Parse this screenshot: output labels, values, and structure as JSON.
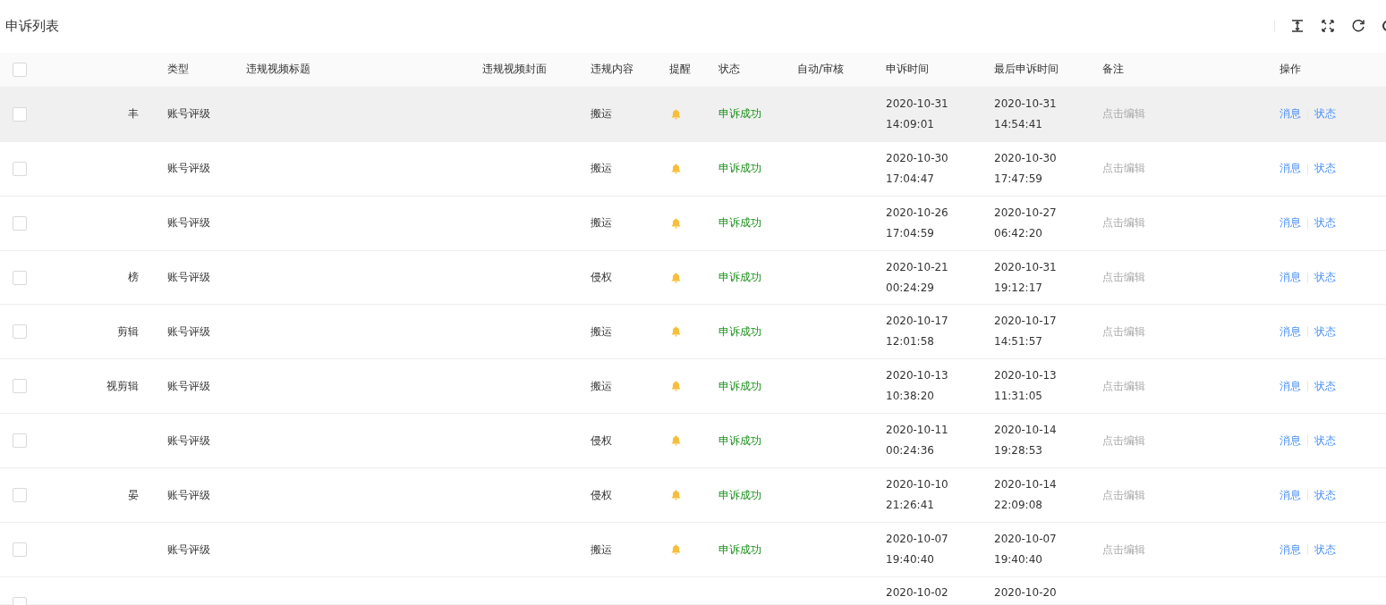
{
  "title": "申诉列表",
  "toolbar": [
    {
      "kind": "height"
    },
    {
      "kind": "fullscreen"
    },
    {
      "kind": "refresh"
    },
    {
      "kind": "settings"
    }
  ],
  "table": {
    "select_all": {
      "checked": false
    },
    "columns": [
      "",
      "类型",
      "违规视频标题",
      "违规视频封面",
      "违规内容",
      "提醒",
      "状态",
      "自动/审核",
      "申诉时间",
      "最后申诉时间",
      "备注",
      "操作"
    ],
    "rows": [
      {
        "kind": "full",
        "hovered": true,
        "checked": false,
        "name": "丰",
        "type": "账号评级",
        "content": "搬运",
        "status": "申诉成功",
        "appeal_date": "2020-10-31",
        "appeal_time": "14:09:01",
        "last_date": "2020-10-31",
        "last_time": "14:54:41",
        "remark": "点击编辑",
        "actions": [
          "消息",
          "状态"
        ]
      },
      {
        "kind": "full",
        "hovered": false,
        "checked": false,
        "name": "",
        "type": "账号评级",
        "content": "搬运",
        "status": "申诉成功",
        "appeal_date": "2020-10-30",
        "appeal_time": "17:04:47",
        "last_date": "2020-10-30",
        "last_time": "17:47:59",
        "remark": "点击编辑",
        "actions": [
          "消息",
          "状态"
        ]
      },
      {
        "kind": "full",
        "hovered": false,
        "checked": false,
        "name": "",
        "type": "账号评级",
        "content": "搬运",
        "status": "申诉成功",
        "appeal_date": "2020-10-26",
        "appeal_time": "17:04:59",
        "last_date": "2020-10-27",
        "last_time": "06:42:20",
        "remark": "点击编辑",
        "actions": [
          "消息",
          "状态"
        ]
      },
      {
        "kind": "full",
        "hovered": false,
        "checked": false,
        "name": "榜",
        "type": "账号评级",
        "content": "侵权",
        "status": "申诉成功",
        "appeal_date": "2020-10-21",
        "appeal_time": "00:24:29",
        "last_date": "2020-10-31",
        "last_time": "19:12:17",
        "remark": "点击编辑",
        "actions": [
          "消息",
          "状态"
        ]
      },
      {
        "kind": "full",
        "hovered": false,
        "checked": false,
        "name": "剪辑",
        "type": "账号评级",
        "content": "搬运",
        "status": "申诉成功",
        "appeal_date": "2020-10-17",
        "appeal_time": "12:01:58",
        "last_date": "2020-10-17",
        "last_time": "14:51:57",
        "remark": "点击编辑",
        "actions": [
          "消息",
          "状态"
        ]
      },
      {
        "kind": "full",
        "hovered": false,
        "checked": false,
        "name": "视剪辑",
        "type": "账号评级",
        "content": "搬运",
        "status": "申诉成功",
        "appeal_date": "2020-10-13",
        "appeal_time": "10:38:20",
        "last_date": "2020-10-13",
        "last_time": "11:31:05",
        "remark": "点击编辑",
        "actions": [
          "消息",
          "状态"
        ]
      },
      {
        "kind": "full",
        "hovered": false,
        "checked": false,
        "name": "",
        "type": "账号评级",
        "content": "侵权",
        "status": "申诉成功",
        "appeal_date": "2020-10-11",
        "appeal_time": "00:24:36",
        "last_date": "2020-10-14",
        "last_time": "19:28:53",
        "remark": "点击编辑",
        "actions": [
          "消息",
          "状态"
        ]
      },
      {
        "kind": "full",
        "hovered": false,
        "checked": false,
        "name": "晏",
        "type": "账号评级",
        "content": "侵权",
        "status": "申诉成功",
        "appeal_date": "2020-10-10",
        "appeal_time": "21:26:41",
        "last_date": "2020-10-14",
        "last_time": "22:09:08",
        "remark": "点击编辑",
        "actions": [
          "消息",
          "状态"
        ]
      },
      {
        "kind": "full",
        "hovered": false,
        "checked": false,
        "name": "",
        "type": "账号评级",
        "content": "搬运",
        "status": "申诉成功",
        "appeal_date": "2020-10-07",
        "appeal_time": "19:40:40",
        "last_date": "2020-10-07",
        "last_time": "19:40:40",
        "remark": "点击编辑",
        "actions": [
          "消息",
          "状态"
        ]
      },
      {
        "kind": "partial",
        "hovered": false,
        "checked": false,
        "appeal_date": "2020-10-02",
        "last_date": "2020-10-20"
      }
    ]
  }
}
